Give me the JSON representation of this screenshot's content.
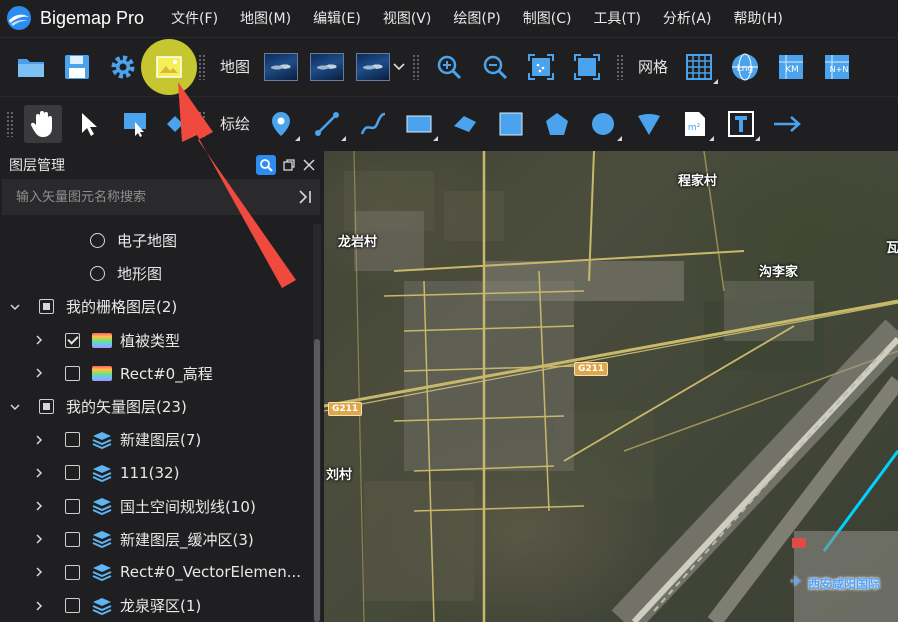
{
  "app": {
    "title": "Bigemap Pro"
  },
  "menu": [
    "文件(F)",
    "地图(M)",
    "编辑(E)",
    "视图(V)",
    "绘图(P)",
    "制图(C)",
    "工具(T)",
    "分析(A)",
    "帮助(H)"
  ],
  "toolbar1": {
    "map_label": "地图",
    "grid_label": "网格",
    "lng_label": "Lng",
    "km_label": "KM",
    "nn_label": "N+N"
  },
  "toolbar2": {
    "draw_label": "标绘",
    "m2_label": "m²"
  },
  "panel": {
    "title": "图层管理",
    "search_placeholder": "输入矢量图元名称搜索",
    "tree": [
      {
        "label": "电子地图",
        "type": "radio"
      },
      {
        "label": "地形图",
        "type": "radio"
      },
      {
        "label": "我的栅格图层(2)",
        "type": "group"
      },
      {
        "label": "植被类型",
        "type": "raster",
        "checked": true
      },
      {
        "label": "Rect#0_高程",
        "type": "raster",
        "checked": false
      },
      {
        "label": "我的矢量图层(23)",
        "type": "group"
      },
      {
        "label": "新建图层(7)",
        "type": "vector"
      },
      {
        "label": "111(32)",
        "type": "vector"
      },
      {
        "label": "国土空间规划线(10)",
        "type": "vector"
      },
      {
        "label": "新建图层_缓冲区(3)",
        "type": "vector"
      },
      {
        "label": "Rect#0_VectorElemen...",
        "type": "vector"
      },
      {
        "label": "龙泉驿区(1)",
        "type": "vector"
      }
    ]
  },
  "map": {
    "labels": {
      "chengjia": "程家村",
      "longyan": "龙岩村",
      "goulijia": "沟李家",
      "liu": "刘村",
      "wa": "瓦",
      "airport": "西安咸阳国际"
    },
    "road": "G211"
  },
  "colors": {
    "highlight": "#c6c631",
    "arrow": "#f04a3e",
    "accent": "#2d8cf0"
  }
}
